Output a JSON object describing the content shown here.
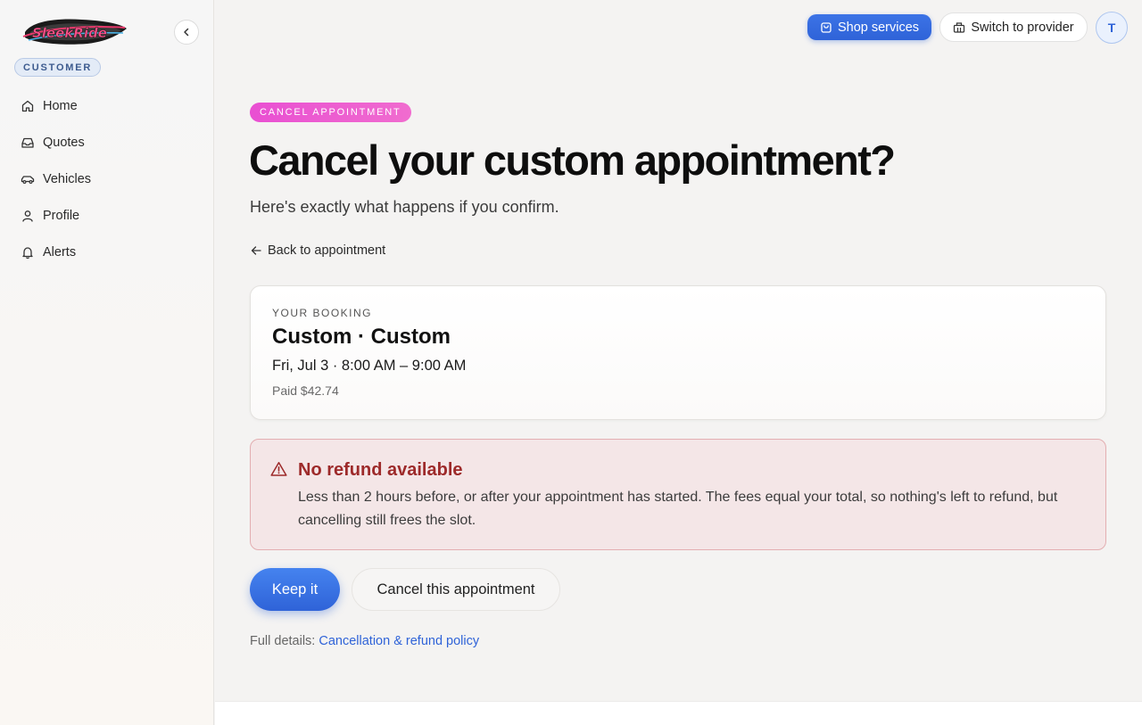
{
  "brand": {
    "logo_text": "SleekRide"
  },
  "sidebar": {
    "role_badge": "CUSTOMER",
    "items": [
      {
        "label": "Home",
        "icon": "home-icon"
      },
      {
        "label": "Quotes",
        "icon": "inbox-icon"
      },
      {
        "label": "Vehicles",
        "icon": "car-icon"
      },
      {
        "label": "Profile",
        "icon": "user-icon"
      },
      {
        "label": "Alerts",
        "icon": "bell-icon"
      }
    ]
  },
  "topbar": {
    "shop_label": "Shop services",
    "switch_label": "Switch to provider",
    "avatar_initial": "T"
  },
  "main": {
    "eyebrow": "CANCEL APPOINTMENT",
    "title": "Cancel your custom appointment?",
    "subtitle": "Here's exactly what happens if you confirm.",
    "back_label": "Back to appointment",
    "booking": {
      "label": "YOUR BOOKING",
      "title": "Custom · Custom",
      "time": "Fri, Jul 3 · 8:00 AM – 9:00 AM",
      "paid": "Paid $42.74"
    },
    "alert": {
      "title": "No refund available",
      "body": "Less than 2 hours before, or after your appointment has started. The fees equal your total, so nothing's left to refund, but cancelling still frees the slot."
    },
    "keep_label": "Keep it",
    "cancel_label": "Cancel this appointment",
    "details_prefix": "Full details:",
    "details_link": "Cancellation & refund policy"
  },
  "colors": {
    "accent": "#2f63d8",
    "eyebrow": "#e94fd2",
    "alert_text": "#9d2a2a",
    "alert_bg": "#f4e6e7"
  }
}
